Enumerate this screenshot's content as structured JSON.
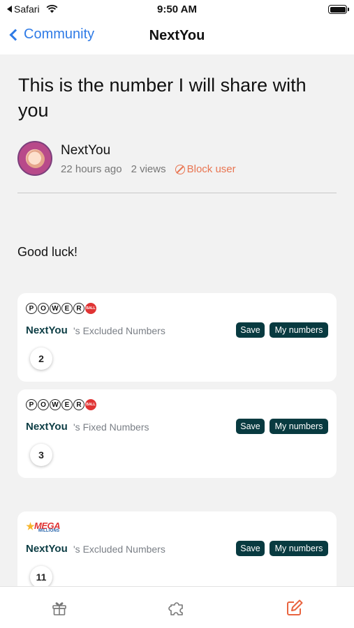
{
  "status_bar": {
    "back_app": "Safari",
    "time": "9:50 AM"
  },
  "nav": {
    "back_label": "Community",
    "title": "NextYou"
  },
  "post": {
    "title": "This is the number I will share with you",
    "author": "NextYou",
    "time_ago": "22 hours ago",
    "views": "2 views",
    "block_label": "Block user",
    "body": "Good luck!"
  },
  "cards": [
    {
      "logo": "powerball-logo",
      "logo_letters": [
        "P",
        "O",
        "W",
        "E",
        "R"
      ],
      "logo_ball": "BALL",
      "owner": "NextYou",
      "label": "'s Excluded Numbers",
      "save": "Save",
      "my_numbers": "My numbers",
      "numbers": [
        "2"
      ]
    },
    {
      "logo": "powerball-logo",
      "logo_letters": [
        "P",
        "O",
        "W",
        "E",
        "R"
      ],
      "logo_ball": "BALL",
      "owner": "NextYou",
      "label": "'s Fixed Numbers",
      "save": "Save",
      "my_numbers": "My numbers",
      "numbers": [
        "3"
      ]
    },
    {
      "logo": "mega-millions-logo",
      "logo_text": "MEGA",
      "logo_subtext": "MILLIONS",
      "owner": "NextYou",
      "label": "'s Excluded Numbers",
      "save": "Save",
      "my_numbers": "My numbers",
      "numbers": [
        "11"
      ]
    }
  ],
  "tabs": [
    {
      "icon": "gift-icon"
    },
    {
      "icon": "puzzle-icon"
    },
    {
      "icon": "edit-icon",
      "active": true
    }
  ],
  "colors": {
    "accent_blue": "#2f7be6",
    "button_dark": "#083a40",
    "block_orange": "#e97551",
    "active_tab": "#e9643f"
  }
}
